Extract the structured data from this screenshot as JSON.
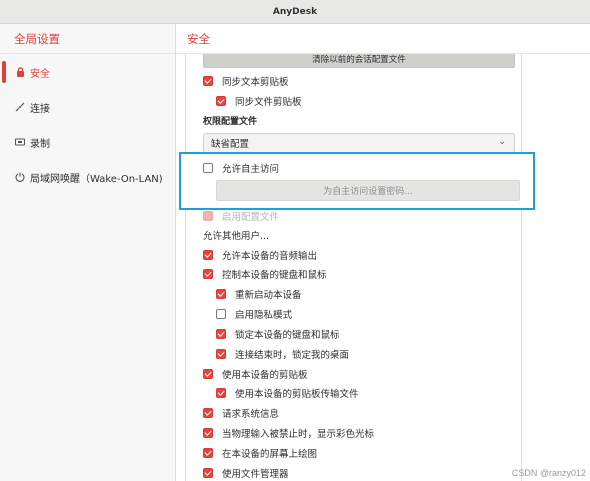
{
  "window": {
    "title": "AnyDesk"
  },
  "sidebar": {
    "header": "全局设置",
    "items": [
      {
        "label": "安全",
        "icon": "lock-icon",
        "active": true
      },
      {
        "label": "连接",
        "icon": "connection-icon",
        "active": false
      },
      {
        "label": "录制",
        "icon": "recording-icon",
        "active": false
      },
      {
        "label": "局域网唤醒（Wake-On-LAN)",
        "icon": "wake-on-lan-icon",
        "active": false
      }
    ]
  },
  "main": {
    "header": "安全",
    "clear_button": "清除以前的会话配置文件",
    "top_options": [
      {
        "label": "同步文本剪贴板",
        "checked": true
      },
      {
        "label": "同步文件剪贴板",
        "checked": true
      }
    ],
    "profile": {
      "label": "权限配置文件",
      "select_value": "缺省配置"
    },
    "unattended": {
      "label": "允许自主访问",
      "checked": false,
      "password_button": "为自主访问设置密码..."
    },
    "enable_profile": {
      "label": "启用配置文件"
    },
    "allow_others_label": "允许其他用户...",
    "permissions": [
      {
        "label": "允许本设备的音频输出",
        "checked": true
      },
      {
        "label": "控制本设备的键盘和鼠标",
        "checked": true
      },
      {
        "label": "重新启动本设备",
        "checked": true
      },
      {
        "label": "启用隐私模式",
        "checked": false
      },
      {
        "label": "锁定本设备的键盘和鼠标",
        "checked": true
      },
      {
        "label": "连接结束时，锁定我的桌面",
        "checked": true
      },
      {
        "label": "使用本设备的剪贴板",
        "checked": true
      },
      {
        "label": "使用本设备的剪贴板传输文件",
        "checked": true
      },
      {
        "label": "请求系统信息",
        "checked": true
      },
      {
        "label": "当物理输入被禁止时，显示彩色光标",
        "checked": true
      },
      {
        "label": "在本设备的屏幕上绘图",
        "checked": true
      },
      {
        "label": "使用文件管理器",
        "checked": true
      }
    ]
  },
  "watermark": "CSDN @ranzy012",
  "colors": {
    "accent": "#e0403a",
    "highlight": "#1f9fd8"
  }
}
